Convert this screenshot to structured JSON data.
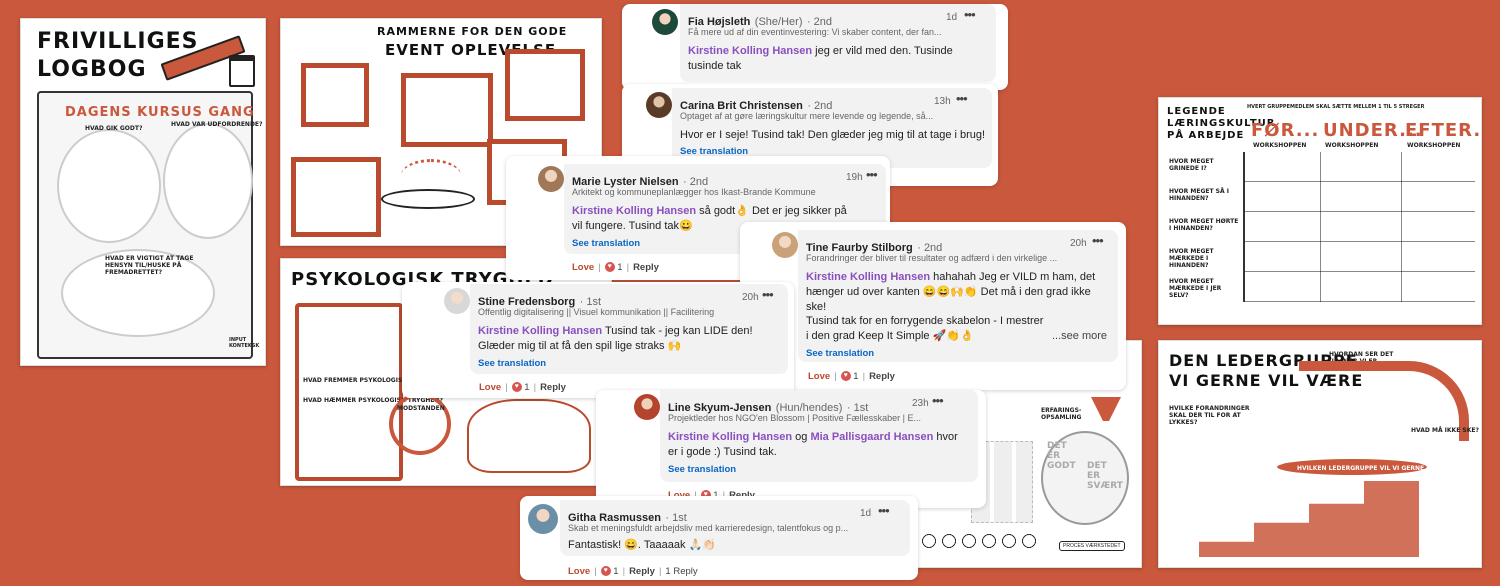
{
  "sheets": {
    "logbog": {
      "title_1": "FRIVILLIGES",
      "title_2": "LOGBOG",
      "kursus": "DAGENS KURSUS GANG",
      "q1": "HVAD GIK GODT?",
      "q2": "HVAD VAR UDFORDRENDE?",
      "q3": "HVAD ER VIGTIGT AT TAGE HENSYN TIL/HUSKE PÅ FREMADRETTET?",
      "brand": "INPUT KONTEKSK"
    },
    "rammerne": {
      "title_1": "RAMMERNE FOR DEN GODE",
      "title_2": "EVENT OPLEVELSE"
    },
    "psykologisk": {
      "title": "PSYKOLOGISK TRYGHED",
      "q1": "HVAD FREMMER PSYKOLOGISK TRYGHED?",
      "q2": "HVAD HÆMMER PSYKOLOGISK TRYGHED?",
      "q3": "MODSTANDEN"
    },
    "proces": {
      "label": "ERFARINGS-OPSAMLING",
      "t1": "DET ER GODT",
      "t2": "DET ER SVÆRT",
      "brand": "PROCES VÆRKSTEDET"
    },
    "legende": {
      "title": "LEGENDE LÆRINGSKULTUR PÅ ARBEJDE",
      "header_note": "HVERT GRUPPEMEDLEM SKAL SÆTTE MELLEM 1 TIL 5 STREGER",
      "col1": "FØR...",
      "col2": "UNDER...",
      "col3": "EFTER...",
      "sub1": "WORKSHOPPEN",
      "sub2": "WORKSHOPPEN",
      "sub3": "WORKSHOPPEN",
      "rows": [
        "HVOR MEGET GRINEDE I?",
        "HVOR MEGET SÅ I HINANDEN?",
        "HVOR MEGET HØRTE I HINANDEN?",
        "HVOR MEGET MÆRKEDE I HINANDEN?",
        "HVOR MEGET MÆRKEDE I JER SELV?"
      ]
    },
    "ledergruppe": {
      "title_1": "DEN LEDERGRUPPE",
      "title_2": "VI GERNE VIL VÆRE",
      "q1": "HVILKE FORANDRINGER SKAL DER TIL FOR AT LYKKES?",
      "q2": "HVAD MÅ IKKE SKE?",
      "q3": "HVILKEN LEDERGRUPPE VIL VI GERNE VÆRE?",
      "q4": "HVORDAN SER DET UD, NÅR VI ER LYKKEDES?"
    }
  },
  "comments": [
    {
      "name": "Fia Højsleth",
      "pronouns": "(She/Her)",
      "degree": "· 2nd",
      "subtitle": "Få mere ud af din eventinvestering: Vi skaber content, der fan...",
      "time": "1d",
      "menu": "•••",
      "mention": "Kirstine Kolling Hansen",
      "text": "jeg er vild med den. Tusinde tusinde tak"
    },
    {
      "name": "Carina Brit Christensen",
      "degree": "· 2nd",
      "subtitle": "Optaget af at gøre læringskultur mere levende og legende, så...",
      "time": "13h",
      "menu": "•••",
      "text": "Hvor er I seje! Tusind tak! Den glæder jeg mig til at tage i brug!",
      "see_translation": "See translation"
    },
    {
      "name": "Marie Lyster Nielsen",
      "degree": "· 2nd",
      "subtitle": "Arkitekt og kommuneplanlægger hos Ikast-Brande Kommune",
      "time": "19h",
      "menu": "•••",
      "mention": "Kirstine Kolling Hansen",
      "text": "så godt👌 Det er jeg sikker på vil fungere. Tusind tak😀",
      "see_translation": "See translation",
      "love": "Love",
      "count": "1",
      "reply": "Reply"
    },
    {
      "name": "Tine Faurby Stilborg",
      "degree": "· 2nd",
      "subtitle": "Forandringer der bliver til resultater og adfærd i den virkelige ...",
      "time": "20h",
      "menu": "•••",
      "mention": "Kirstine Kolling Hansen",
      "text": "hahahah Jeg er VILD m ham, det hænger ud over kanten 😄😄🙌👏 Det må i den grad ikke ske!",
      "text2": "Tusind tak for en forrygende skabelon - I mestrer i den grad Keep It Simple 🚀👏👌",
      "see_more": "...see more",
      "see_translation": "See translation",
      "love": "Love",
      "count": "1",
      "reply": "Reply"
    },
    {
      "name": "Stine Fredensborg",
      "degree": "· 1st",
      "subtitle": "Offentlig digitalisering || Visuel kommunikation || Facilitering",
      "time": "20h",
      "menu": "•••",
      "mention": "Kirstine Kolling Hansen",
      "text": "Tusind tak - jeg kan LIDE den! Glæder mig til at få den spil lige straks 🙌",
      "see_translation": "See translation",
      "love": "Love",
      "count": "1",
      "reply": "Reply"
    },
    {
      "name": "Line Skyum-Jensen",
      "pronouns": "(Hun/hendes)",
      "degree": "· 1st",
      "subtitle": "Projektleder hos NGO'en Blossom | Positive Fællesskaber | E...",
      "time": "23h",
      "menu": "•••",
      "mention": "Kirstine Kolling Hansen",
      "joiner": "og",
      "mention2": "Mia Pallisgaard Hansen",
      "text": "hvor er i gode :) Tusind tak.",
      "see_translation": "See translation",
      "love": "Love",
      "count": "1",
      "reply": "Reply"
    },
    {
      "name": "Githa Rasmussen",
      "degree": "· 1st",
      "subtitle": "Skab et meningsfuldt arbejdsliv med karrieredesign, talentfokus og p...",
      "time": "1d",
      "menu": "•••",
      "text": "Fantastisk! 😄. Taaaaak 🙏🏻👏🏻",
      "love": "Love",
      "count": "1",
      "reply": "Reply",
      "replies": "1 Reply"
    }
  ],
  "colors": {
    "background": "#c9583c",
    "accent": "#b94a2e",
    "mention": "#8a4fbf",
    "link": "#0a66c2"
  }
}
